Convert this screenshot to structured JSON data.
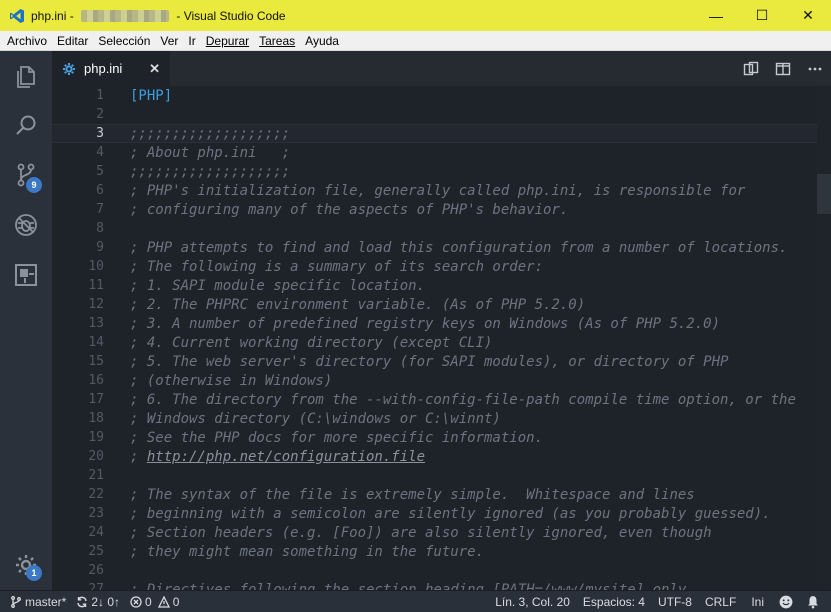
{
  "window": {
    "title_file": "php.ini",
    "title_separator": " - ",
    "title_app": "Visual Studio Code",
    "minimize_glyph": "—",
    "maximize_glyph": "☐",
    "close_glyph": "✕"
  },
  "menu": {
    "items": [
      "Archivo",
      "Editar",
      "Selección",
      "Ver",
      "Ir",
      "Depurar",
      "Tareas",
      "Ayuda"
    ]
  },
  "activity_bar": {
    "items": [
      {
        "icon": "explorer-icon"
      },
      {
        "icon": "search-icon"
      },
      {
        "icon": "source-control-icon",
        "badge": "9"
      },
      {
        "icon": "debug-icon"
      },
      {
        "icon": "extensions-icon"
      }
    ],
    "settings_badge": "1"
  },
  "tabs": [
    {
      "label": "php.ini",
      "close_glyph": "✕",
      "active": true
    }
  ],
  "editor": {
    "current_line": 3,
    "lines": [
      {
        "n": "1",
        "text": "[PHP]",
        "kind": "section"
      },
      {
        "n": "2",
        "text": "",
        "kind": "comment"
      },
      {
        "n": "3",
        "text": ";;;;;;;;;;;;;;;;;;;",
        "kind": "comment"
      },
      {
        "n": "4",
        "text": "; About php.ini   ;",
        "kind": "comment"
      },
      {
        "n": "5",
        "text": ";;;;;;;;;;;;;;;;;;;",
        "kind": "comment"
      },
      {
        "n": "6",
        "text": "; PHP's initialization file, generally called php.ini, is responsible for",
        "kind": "comment"
      },
      {
        "n": "7",
        "text": "; configuring many of the aspects of PHP's behavior.",
        "kind": "comment"
      },
      {
        "n": "8",
        "text": "",
        "kind": "comment"
      },
      {
        "n": "9",
        "text": "; PHP attempts to find and load this configuration from a number of locations.",
        "kind": "comment"
      },
      {
        "n": "10",
        "text": "; The following is a summary of its search order:",
        "kind": "comment"
      },
      {
        "n": "11",
        "text": "; 1. SAPI module specific location.",
        "kind": "comment"
      },
      {
        "n": "12",
        "text": "; 2. The PHPRC environment variable. (As of PHP 5.2.0)",
        "kind": "comment"
      },
      {
        "n": "13",
        "text": "; 3. A number of predefined registry keys on Windows (As of PHP 5.2.0)",
        "kind": "comment"
      },
      {
        "n": "14",
        "text": "; 4. Current working directory (except CLI)",
        "kind": "comment"
      },
      {
        "n": "15",
        "text": "; 5. The web server's directory (for SAPI modules), or directory of PHP",
        "kind": "comment"
      },
      {
        "n": "16",
        "text": "; (otherwise in Windows)",
        "kind": "comment"
      },
      {
        "n": "17",
        "text": "; 6. The directory from the --with-config-file-path compile time option, or the",
        "kind": "comment"
      },
      {
        "n": "18",
        "text": "; Windows directory (C:\\windows or C:\\winnt)",
        "kind": "comment"
      },
      {
        "n": "19",
        "text": "; See the PHP docs for more specific information.",
        "kind": "comment"
      },
      {
        "n": "20",
        "text": "; ",
        "link": "http://php.net/configuration.file",
        "kind": "comment"
      },
      {
        "n": "21",
        "text": "",
        "kind": "comment"
      },
      {
        "n": "22",
        "text": "; The syntax of the file is extremely simple.  Whitespace and lines",
        "kind": "comment"
      },
      {
        "n": "23",
        "text": "; beginning with a semicolon are silently ignored (as you probably guessed).",
        "kind": "comment"
      },
      {
        "n": "24",
        "text": "; Section headers (e.g. [Foo]) are also silently ignored, even though",
        "kind": "comment"
      },
      {
        "n": "25",
        "text": "; they might mean something in the future.",
        "kind": "comment"
      },
      {
        "n": "26",
        "text": "",
        "kind": "comment"
      },
      {
        "n": "27",
        "text": "; Directives following the section heading [PATH=/www/mysite] only",
        "kind": "comment"
      }
    ]
  },
  "status": {
    "branch": "master*",
    "sync": "2↓ 0↑",
    "errors": "0",
    "warnings": "0",
    "position": "Lín. 3, Col. 20",
    "indent": "Espacios: 4",
    "encoding": "UTF-8",
    "eol": "CRLF",
    "language": "Ini"
  },
  "colors": {
    "titlebar": "#e9e93e",
    "activitybar": "#2b313a",
    "editor_bg": "#1e2329",
    "badge": "#3b78c5",
    "section": "#3d9fe0"
  }
}
